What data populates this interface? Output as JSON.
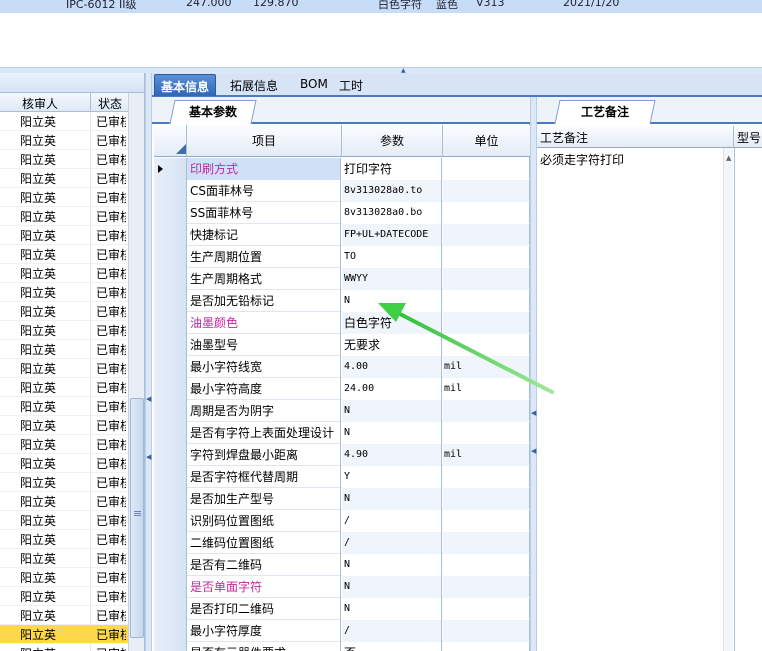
{
  "top_row": {
    "model": "IPC-6012 II级",
    "num1": "247.000",
    "num2": "129.870",
    "char_color": "白色字符",
    "ink": "蓝色",
    "code": "V313",
    "date": "2021/1/20"
  },
  "left_panel": {
    "col_reviewer": "核审人",
    "col_status": "状态",
    "rows": [
      {
        "reviewer": "阳立英",
        "status": "已审核"
      },
      {
        "reviewer": "阳立英",
        "status": "已审核"
      },
      {
        "reviewer": "阳立英",
        "status": "已审核"
      },
      {
        "reviewer": "阳立英",
        "status": "已审核"
      },
      {
        "reviewer": "阳立英",
        "status": "已审核"
      },
      {
        "reviewer": "阳立英",
        "status": "已审核"
      },
      {
        "reviewer": "阳立英",
        "status": "已审核"
      },
      {
        "reviewer": "阳立英",
        "status": "已审核"
      },
      {
        "reviewer": "阳立英",
        "status": "已审核"
      },
      {
        "reviewer": "阳立英",
        "status": "已审核"
      },
      {
        "reviewer": "阳立英",
        "status": "已审核"
      },
      {
        "reviewer": "阳立英",
        "status": "已审核"
      },
      {
        "reviewer": "阳立英",
        "status": "已审核"
      },
      {
        "reviewer": "阳立英",
        "status": "已审核"
      },
      {
        "reviewer": "阳立英",
        "status": "已审核"
      },
      {
        "reviewer": "阳立英",
        "status": "已审核"
      },
      {
        "reviewer": "阳立英",
        "status": "已审核"
      },
      {
        "reviewer": "阳立英",
        "status": "已审核"
      },
      {
        "reviewer": "阳立英",
        "status": "已审核"
      },
      {
        "reviewer": "阳立英",
        "status": "已审核"
      },
      {
        "reviewer": "阳立英",
        "status": "已审核"
      },
      {
        "reviewer": "阳立英",
        "status": "已审核"
      },
      {
        "reviewer": "阳立英",
        "status": "已审核"
      },
      {
        "reviewer": "阳立英",
        "status": "已审核"
      },
      {
        "reviewer": "阳立英",
        "status": "已审核"
      },
      {
        "reviewer": "阳立英",
        "status": "已审核"
      },
      {
        "reviewer": "阳立英",
        "status": "已审核"
      },
      {
        "reviewer": "阳立英",
        "status": "已审核"
      },
      {
        "reviewer": "阳立英",
        "status": "已审核"
      }
    ],
    "selected_row": 27
  },
  "tabs": [
    "基本信息",
    "拓展信息",
    "BOM",
    "工时"
  ],
  "active_tab": 0,
  "basic_params_tab": "基本参数",
  "grid": {
    "col_item": "项目",
    "col_param": "参数",
    "col_unit": "单位",
    "rows": [
      {
        "item": "印刷方式",
        "param": "打印字符",
        "unit": "",
        "red": true,
        "selected": true
      },
      {
        "item": "CS面菲林号",
        "param": "8v313028a0.to",
        "unit": ""
      },
      {
        "item": "SS面菲林号",
        "param": "8v313028a0.bo",
        "unit": ""
      },
      {
        "item": "快捷标记",
        "param": "FP+UL+DATECODE",
        "unit": ""
      },
      {
        "item": "生产周期位置",
        "param": "TO",
        "unit": ""
      },
      {
        "item": "生产周期格式",
        "param": "WWYY",
        "unit": ""
      },
      {
        "item": "是否加无铅标记",
        "param": "N",
        "unit": ""
      },
      {
        "item": "油墨颜色",
        "param": "白色字符",
        "unit": "",
        "red": true
      },
      {
        "item": "油墨型号",
        "param": "无要求",
        "unit": ""
      },
      {
        "item": "最小字符线宽",
        "param": "4.00",
        "unit": "mil"
      },
      {
        "item": "最小字符高度",
        "param": "24.00",
        "unit": "mil"
      },
      {
        "item": "周期是否为阴字",
        "param": "N",
        "unit": ""
      },
      {
        "item": "是否有字符上表面处理设计",
        "param": "N",
        "unit": ""
      },
      {
        "item": "字符到焊盘最小距离",
        "param": "4.90",
        "unit": "mil"
      },
      {
        "item": "是否字符框代替周期",
        "param": "Y",
        "unit": ""
      },
      {
        "item": "是否加生产型号",
        "param": "N",
        "unit": ""
      },
      {
        "item": "识别码位置图纸",
        "param": "/",
        "unit": ""
      },
      {
        "item": "二维码位置图纸",
        "param": "/",
        "unit": ""
      },
      {
        "item": "是否有二维码",
        "param": "N",
        "unit": ""
      },
      {
        "item": "是否单面字符",
        "param": "N",
        "unit": "",
        "red": true
      },
      {
        "item": "是否打印二维码",
        "param": "N",
        "unit": ""
      },
      {
        "item": "最小字符厚度",
        "param": "/",
        "unit": ""
      },
      {
        "item": "是否有元器件要求",
        "param": "否",
        "unit": ""
      }
    ]
  },
  "right_panel": {
    "tab": "工艺备注",
    "col_note": "工艺备注",
    "col_model": "型号",
    "note": "必须走字符打印"
  },
  "colors": {
    "accent": "#2f66b5",
    "selected_row": "#fdd84a",
    "red_label": "#c0289e",
    "arrow": "#6fdc6f"
  }
}
